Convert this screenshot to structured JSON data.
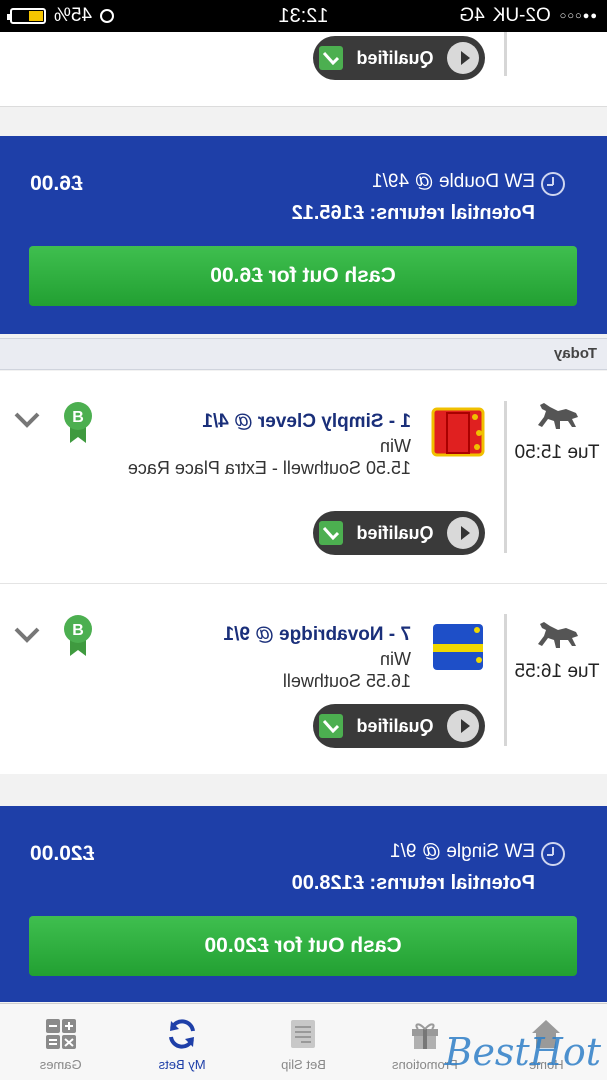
{
  "status_bar": {
    "carrier": "O2-UK",
    "network": "4G",
    "time": "12:31",
    "battery": "45%",
    "battery_level": 0.45
  },
  "top_leg": {
    "status": "Qualified"
  },
  "bet1": {
    "type": "EW Double @ 49/1",
    "returns": "Potential returns: £165.12",
    "stake": "£6.00",
    "cashout": "Cash Out for £6.00"
  },
  "section": {
    "header": "Today"
  },
  "legs": [
    {
      "time": "Tue 15:50",
      "title": "1 - Simply Clever @ 4/1",
      "market": "Win",
      "race": "15.50 Southwell - Extra Place Race",
      "badge": "B",
      "status": "Qualified",
      "silks_colors": [
        "#e02020",
        "#f0c000"
      ]
    },
    {
      "time": "Tue 16:55",
      "title": "7 - Novabridge @ 9/1",
      "market": "Win",
      "race": "16.55 Southwell",
      "badge": "B",
      "status": "Qualified",
      "silks_colors": [
        "#1e4fc8",
        "#f0d800"
      ]
    }
  ],
  "bet2": {
    "type": "EW Single @ 9/1",
    "returns": "Potential returns: £128.00",
    "stake": "£20.00",
    "cashout": "Cash Out for £20.00"
  },
  "tabbar": {
    "items": [
      {
        "label": "Home",
        "icon": "home-icon"
      },
      {
        "label": "Promotions",
        "icon": "gift-icon"
      },
      {
        "label": "Bet Slip",
        "icon": "betslip-icon"
      },
      {
        "label": "My Bets",
        "icon": "refresh-icon"
      },
      {
        "label": "Games",
        "icon": "calculator-icon"
      }
    ]
  },
  "watermark": "BestHot",
  "colors": {
    "brand_blue": "#1e3fa8",
    "cashout_green": "#2eaa3e",
    "title_blue": "#1a2f7a",
    "badge_green": "#4caf50"
  }
}
